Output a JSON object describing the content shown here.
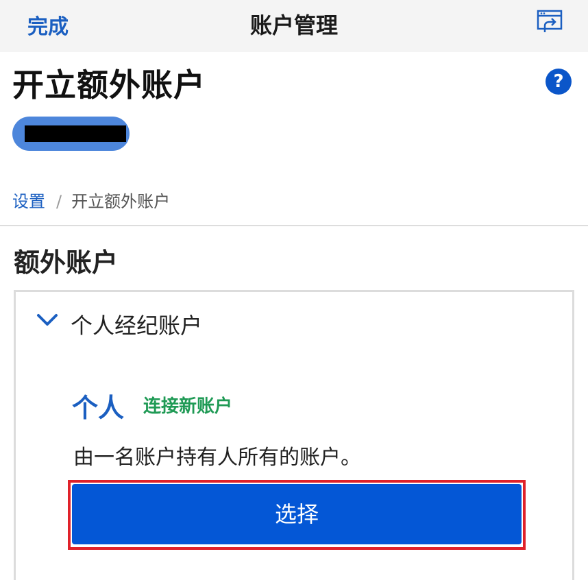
{
  "header": {
    "done_label": "完成",
    "title": "账户管理",
    "share_icon": "share-window-icon"
  },
  "page": {
    "title": "开立额外账户",
    "help_icon_glyph": "?"
  },
  "breadcrumb": {
    "parent": "设置",
    "separator": "/",
    "current": "开立额外账户"
  },
  "section": {
    "title": "额外账户"
  },
  "panel": {
    "label": "个人经纪账户",
    "card": {
      "title": "个人",
      "tag": "连接新账户",
      "description": "由一名账户持有人所有的账户。",
      "button_label": "选择"
    }
  },
  "colors": {
    "accent_blue": "#0457d6",
    "link_blue": "#1b5fc1",
    "tag_green": "#1f9a55",
    "highlight_red": "#e0222a",
    "pill_blue": "#4d86db"
  }
}
